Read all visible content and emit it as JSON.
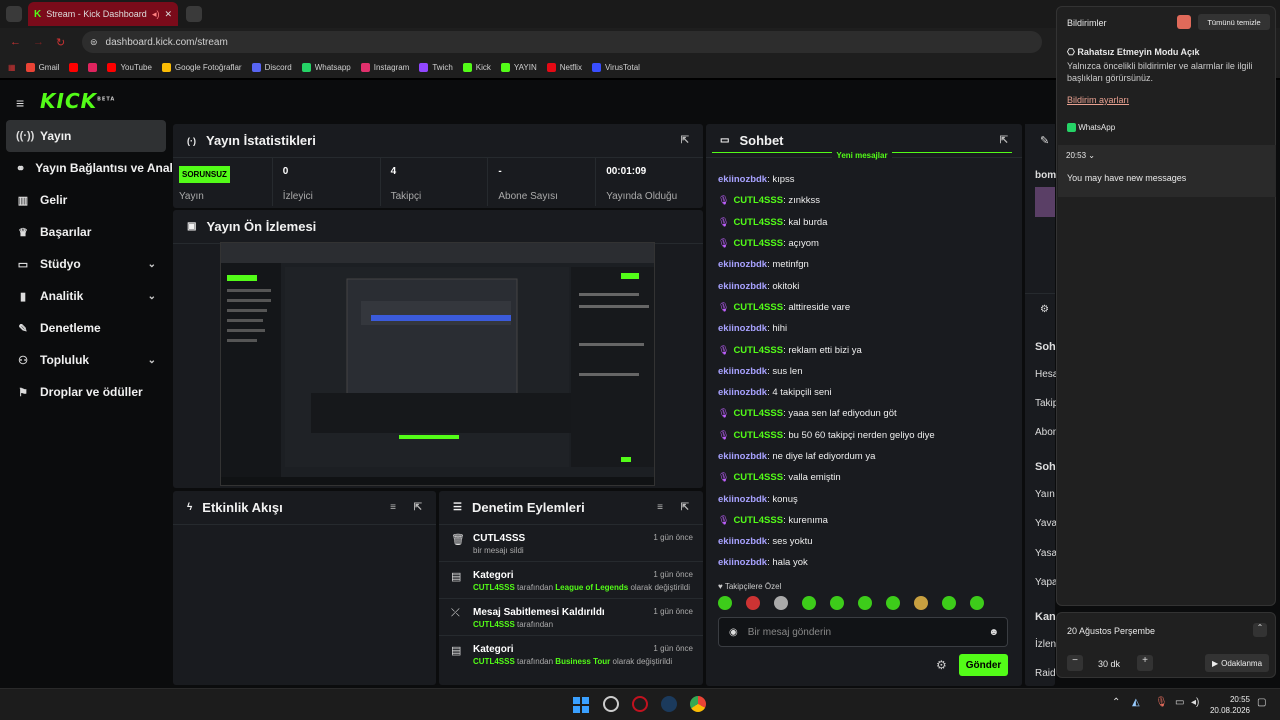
{
  "browser": {
    "tab_title": "Stream - Kick Dashboard",
    "url": "dashboard.kick.com/stream",
    "bookmarks": [
      {
        "label": "Gmail",
        "color": "#ea4335"
      },
      {
        "label": "",
        "color": "#ff0000"
      },
      {
        "label": "",
        "color": "#e0245e"
      },
      {
        "label": "YouTube",
        "color": "#ff0000"
      },
      {
        "label": "Google Fotoğraflar",
        "color": "#fbbc05"
      },
      {
        "label": "Discord",
        "color": "#5865f2"
      },
      {
        "label": "Whatsapp",
        "color": "#25d366"
      },
      {
        "label": "Instagram",
        "color": "#e1306c"
      },
      {
        "label": "Twich",
        "color": "#9146ff"
      },
      {
        "label": "Kick",
        "color": "#53fc18"
      },
      {
        "label": "YAYIN",
        "color": "#53fc18"
      },
      {
        "label": "Netflix",
        "color": "#e50914"
      },
      {
        "label": "VirusTotal",
        "color": "#394eff"
      }
    ]
  },
  "brand": {
    "logo": "KICK",
    "beta": "BETA",
    "accent": "#53fc18"
  },
  "sidebar": {
    "items": [
      {
        "label": "Yayın",
        "icon": "broadcast-icon"
      },
      {
        "label": "Yayın Bağlantısı ve Anahtarı",
        "icon": "link-icon"
      },
      {
        "label": "Gelir",
        "icon": "chart-icon"
      },
      {
        "label": "Başarılar",
        "icon": "trophy-icon"
      },
      {
        "label": "Stüdyo",
        "icon": "studio-icon"
      },
      {
        "label": "Analitik",
        "icon": "analytics-icon"
      },
      {
        "label": "Denetleme",
        "icon": "wrench-icon"
      },
      {
        "label": "Topluluk",
        "icon": "community-icon"
      },
      {
        "label": "Droplar ve ödüller",
        "icon": "gift-icon"
      }
    ]
  },
  "stats": {
    "title": "Yayın İstatistikleri",
    "badge": "SORUNSUZ",
    "status_label": "Yayın",
    "viewers": {
      "value": "0",
      "label": "İzleyici"
    },
    "followers": {
      "value": "4",
      "label": "Takipçi"
    },
    "subs": {
      "value": "-",
      "label": "Abone Sayısı"
    },
    "uptime": {
      "value": "00:01:09",
      "label": "Yayında Olduğu"
    }
  },
  "preview": {
    "title": "Yayın Ön İzlemesi"
  },
  "events": {
    "title": "Etkinlik Akışı"
  },
  "modlog": {
    "title": "Denetim Eylemleri",
    "items": [
      {
        "title": "CUTL4SSS",
        "desc": "bir mesajı sildi",
        "time": "1 gün önce"
      },
      {
        "title": "Kategori",
        "user": "CUTL4SSS",
        "mid": "tarafından",
        "highlight": "League of Legends",
        "after": "olarak değiştirildi",
        "time": "1 gün önce"
      },
      {
        "title": "Mesaj Sabitlemesi Kaldırıldı",
        "user": "CUTL4SSS",
        "mid": "tarafından",
        "time": "1 gün önce"
      },
      {
        "title": "Kategori",
        "user": "CUTL4SSS",
        "mid": "tarafından",
        "highlight": "Business Tour",
        "after": "olarak değiştirildi",
        "time": "1 gün önce"
      }
    ]
  },
  "chat": {
    "title": "Sohbet",
    "new_messages": "Yeni mesajlar",
    "messages": [
      {
        "user": "ekiinozbdk",
        "text": "kıpss",
        "mic": false
      },
      {
        "user": "CUTL4SSS",
        "text": "zınkkss",
        "mic": true
      },
      {
        "user": "CUTL4SSS",
        "text": "kal burda",
        "mic": true
      },
      {
        "user": "CUTL4SSS",
        "text": "açıyom",
        "mic": true
      },
      {
        "user": "ekiinozbdk",
        "text": "metinfgn",
        "mic": false
      },
      {
        "user": "ekiinozbdk",
        "text": "okitoki",
        "mic": false
      },
      {
        "user": "CUTL4SSS",
        "text": "alttireside vare",
        "mic": true
      },
      {
        "user": "ekiinozbdk",
        "text": "hihi",
        "mic": false
      },
      {
        "user": "CUTL4SSS",
        "text": "reklam etti bizi ya",
        "mic": true
      },
      {
        "user": "ekiinozbdk",
        "text": "sus len",
        "mic": false
      },
      {
        "user": "ekiinozbdk",
        "text": "4 takipçili seni",
        "mic": false
      },
      {
        "user": "CUTL4SSS",
        "text": "yaaa sen laf ediyodun göt",
        "mic": true
      },
      {
        "user": "CUTL4SSS",
        "text": "bu 50 60 takipçi nerden geliyo diye",
        "mic": true
      },
      {
        "user": "ekiinozbdk",
        "text": "ne diye laf ediyordum ya",
        "mic": false
      },
      {
        "user": "CUTL4SSS",
        "text": "valla emiştin",
        "mic": true
      },
      {
        "user": "ekiinozbdk",
        "text": "konuş",
        "mic": false
      },
      {
        "user": "CUTL4SSS",
        "text": "kurenıma",
        "mic": true
      },
      {
        "user": "ekiinozbdk",
        "text": "ses yoktu",
        "mic": false
      },
      {
        "user": "ekiinozbdk",
        "text": "hala yok",
        "mic": false
      }
    ],
    "followers_only": "Takipçilere Özel",
    "input_placeholder": "Bir mesaj gönderin",
    "send_label": "Gönder"
  },
  "right_partial": {
    "labels": [
      "bom",
      "Soh",
      "Hesa",
      "Takip",
      "Abon",
      "Soh",
      "Yaın",
      "Yava",
      "Yasa",
      "Yapa",
      "Kan",
      "İzlen",
      "Raid"
    ]
  },
  "notifications": {
    "title": "Bildirimler",
    "clear_all": "Tümünü temizle",
    "dnd_title": "Rahatsız Etmeyin Modu Açık",
    "dnd_text": "Yalnızca öncelikli bildirimler ve alarmlar ile ilgili başlıkları görürsünüz.",
    "settings_link": "Bildirim ayarları",
    "app": "WhatsApp",
    "time": "20:53",
    "message": "You may have new messages",
    "date": "20 Ağustos Perşembe",
    "focus_minutes": "30",
    "focus_unit": "dk",
    "focus_label": "Odaklanma"
  },
  "taskbar": {
    "time": "20:55",
    "date": "20.08.2026"
  }
}
